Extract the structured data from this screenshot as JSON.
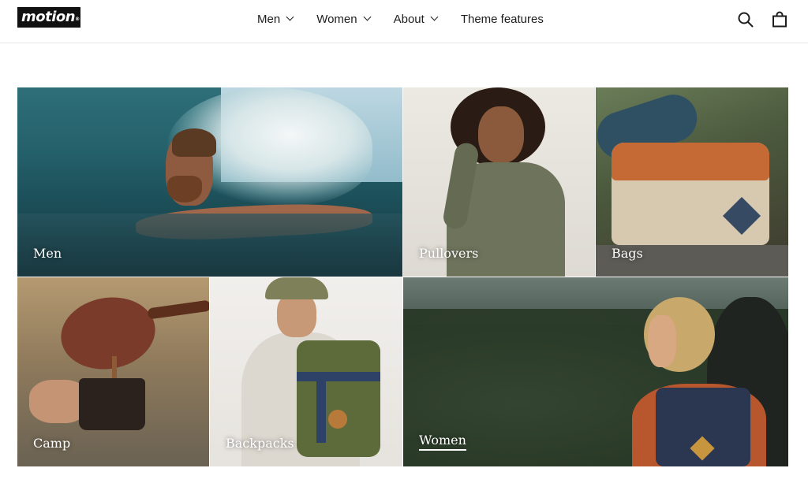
{
  "brand": {
    "logo_text": "motion",
    "logo_mark": "®"
  },
  "nav": {
    "items": [
      {
        "label": "Men",
        "has_dropdown": true
      },
      {
        "label": "Women",
        "has_dropdown": true
      },
      {
        "label": "About",
        "has_dropdown": true
      },
      {
        "label": "Theme features",
        "has_dropdown": false
      }
    ]
  },
  "header_icons": {
    "search": "search-icon",
    "cart": "cart-icon"
  },
  "collections": [
    {
      "label": "Men"
    },
    {
      "label": "Pullovers"
    },
    {
      "label": "Bags"
    },
    {
      "label": "Camp"
    },
    {
      "label": "Backpacks"
    },
    {
      "label": "Women",
      "underlined": true
    }
  ],
  "colors": {
    "text": "#1c1d1d",
    "header_border": "#e8e8e8",
    "background": "#ffffff"
  }
}
